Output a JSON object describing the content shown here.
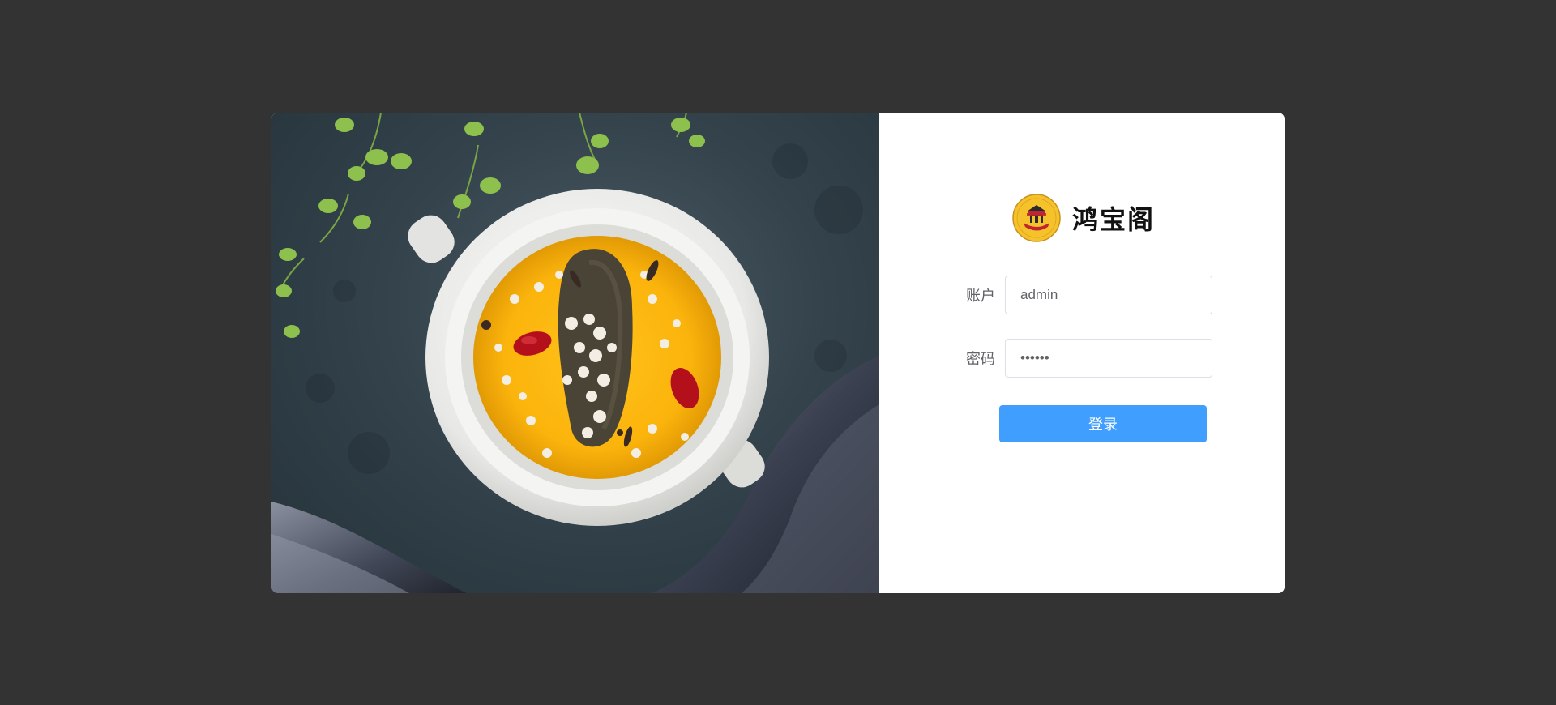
{
  "brand": {
    "name": "鸿宝阁",
    "logo_icon": "restaurant-logo-icon"
  },
  "hero": {
    "image_icon": "soup-dish-photo-icon"
  },
  "form": {
    "account_label": "账户",
    "account_value": "admin",
    "password_label": "密码",
    "password_value": "123456",
    "submit_label": "登录"
  },
  "colors": {
    "page_background": "#333333",
    "primary_button": "#409eff",
    "card_background": "#ffffff"
  }
}
